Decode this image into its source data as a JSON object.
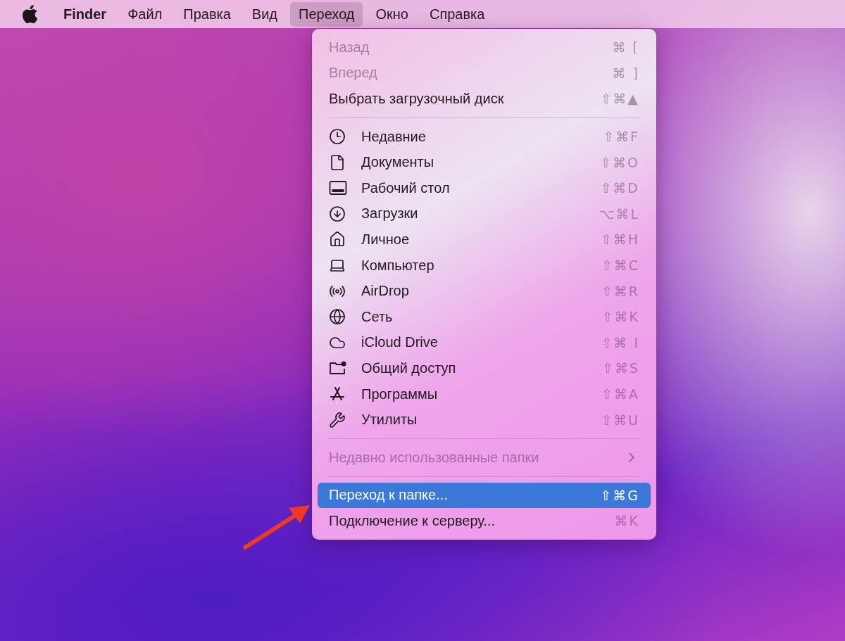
{
  "menu_bar": {
    "items": [
      {
        "label": "Finder",
        "kind": "app",
        "selected": false
      },
      {
        "label": "Файл",
        "kind": "menu",
        "selected": false
      },
      {
        "label": "Правка",
        "kind": "menu",
        "selected": false
      },
      {
        "label": "Вид",
        "kind": "menu",
        "selected": false
      },
      {
        "label": "Переход",
        "kind": "menu",
        "selected": true
      },
      {
        "label": "Окно",
        "kind": "menu",
        "selected": false
      },
      {
        "label": "Справка",
        "kind": "menu",
        "selected": false
      }
    ]
  },
  "menu": {
    "sections": [
      {
        "kind": "plain",
        "items": [
          {
            "label": "Назад",
            "shortcut": "⌘ [",
            "disabled": true,
            "selected": false
          },
          {
            "label": "Вперед",
            "shortcut": "⌘ ]",
            "disabled": true,
            "selected": false
          },
          {
            "label": "Выбрать загрузочный диск",
            "shortcut": "⇧⌘▲",
            "disabled": false,
            "selected": false
          }
        ]
      },
      {
        "kind": "places",
        "items": [
          {
            "label": "Недавние",
            "shortcut": "⇧⌘F",
            "disabled": false,
            "selected": false
          },
          {
            "label": "Документы",
            "shortcut": "⇧⌘O",
            "disabled": false,
            "selected": false
          },
          {
            "label": "Рабочий стол",
            "shortcut": "⇧⌘D",
            "disabled": false,
            "selected": false
          },
          {
            "label": "Загрузки",
            "shortcut": "⌥⌘L",
            "disabled": false,
            "selected": false
          },
          {
            "label": "Личное",
            "shortcut": "⇧⌘H",
            "disabled": false,
            "selected": false
          },
          {
            "label": "Компьютер",
            "shortcut": "⇧⌘C",
            "disabled": false,
            "selected": false
          },
          {
            "label": "AirDrop",
            "shortcut": "⇧⌘R",
            "disabled": false,
            "selected": false
          },
          {
            "label": "Сеть",
            "shortcut": "⇧⌘K",
            "disabled": false,
            "selected": false
          },
          {
            "label": "iCloud Drive",
            "shortcut": "⇧⌘ I",
            "disabled": false,
            "selected": false
          },
          {
            "label": "Общий доступ",
            "shortcut": "⇧⌘S",
            "disabled": false,
            "selected": false
          },
          {
            "label": "Программы",
            "shortcut": "⇧⌘A",
            "disabled": false,
            "selected": false
          },
          {
            "label": "Утилиты",
            "shortcut": "⇧⌘U",
            "disabled": false,
            "selected": false
          }
        ]
      },
      {
        "kind": "submenu",
        "items": [
          {
            "label": "Недавно использованные папки",
            "disabled": true,
            "selected": false
          }
        ]
      },
      {
        "kind": "plain",
        "items": [
          {
            "label": "Переход к папке...",
            "shortcut": "⇧⌘G",
            "disabled": false,
            "selected": true
          },
          {
            "label": "Подключение к серверу...",
            "shortcut": "⌘K",
            "disabled": false,
            "selected": false
          }
        ]
      }
    ]
  }
}
